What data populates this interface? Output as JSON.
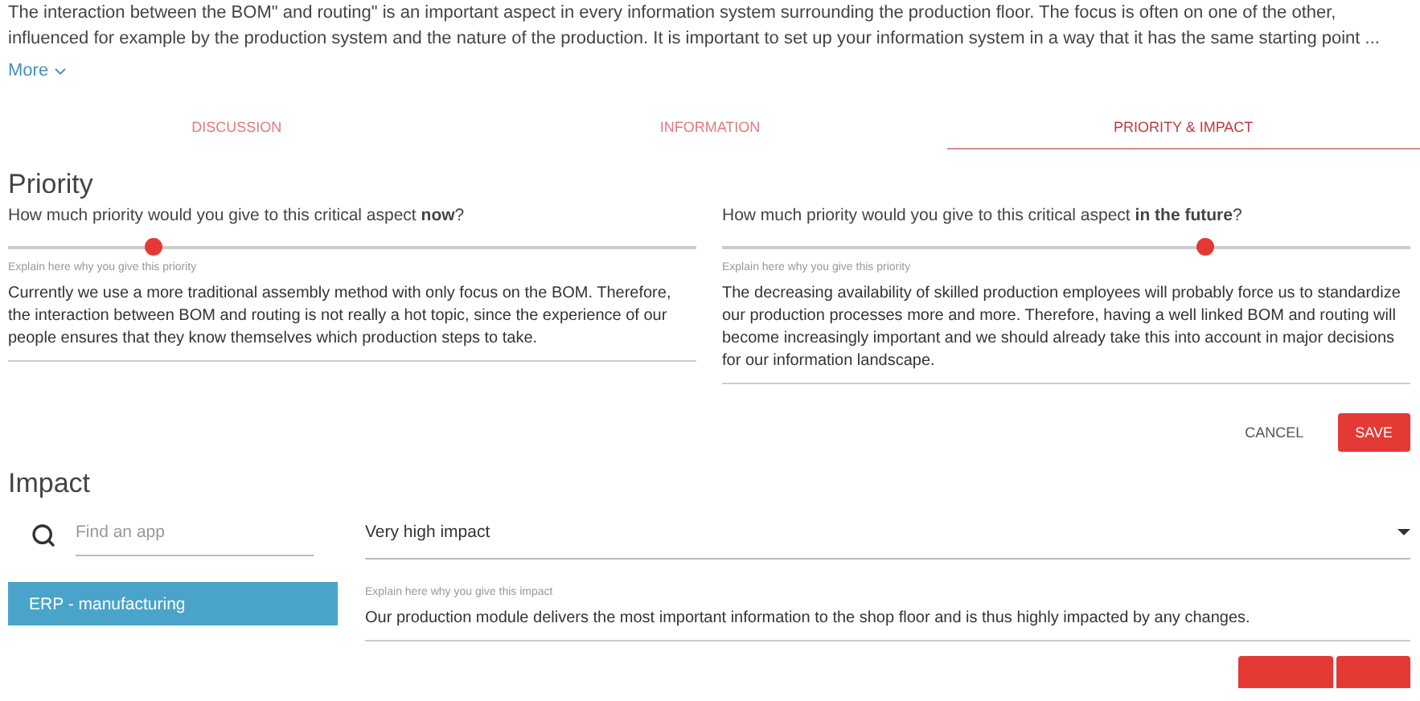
{
  "intro": {
    "text": "The interaction between the BOM\" and routing\" is an important aspect in every information system surrounding the production floor. The focus is often on one of the other, influenced for example by the production system and the nature of the production. It is important to set up your information system in a way that it has the same starting point ...",
    "more": "More"
  },
  "tabs": [
    {
      "label": "DISCUSSION",
      "selected": false
    },
    {
      "label": "INFORMATION",
      "selected": false
    },
    {
      "label": "PRIORITY & IMPACT",
      "selected": true
    }
  ],
  "priority": {
    "title": "Priority",
    "questions": [
      {
        "question": "How much priority would you give to this critical aspect **now**?",
        "level": 0.21,
        "hint": "Explain here why you give this priority",
        "answer": "Currently we use a more traditional assembly method with only focus on the BOM. Therefore, the interaction between BOM and routing is not really a hot topic, since the experience of our people ensures that they know themselves which production steps to take."
      },
      {
        "question": "How much priority would you give to this critical aspect **in the future**?",
        "level": 0.7,
        "hint": "Explain here why you give this priority",
        "answer": "The decreasing availability of skilled production employees will probably force us to standardize our production processes more and more. Therefore, having a well linked BOM and routing will become increasingly important and we should already take this into account in major decisions for our information landscape."
      }
    ],
    "buttons": [
      {
        "label": "CANCEL",
        "kind": "flat"
      },
      {
        "label": "SAVE",
        "kind": "raised"
      }
    ]
  },
  "impact": {
    "title": "Impact",
    "search": {
      "placeholder": "Find an app"
    },
    "apps": [
      {
        "label": "ERP - manufacturing",
        "selected": true
      }
    ],
    "select": {
      "value": "Very high impact"
    },
    "hint": "Explain here why you give this impact",
    "answer": "Our production module delivers the most important information to the shop floor and is thus highly impacted by any changes."
  }
}
